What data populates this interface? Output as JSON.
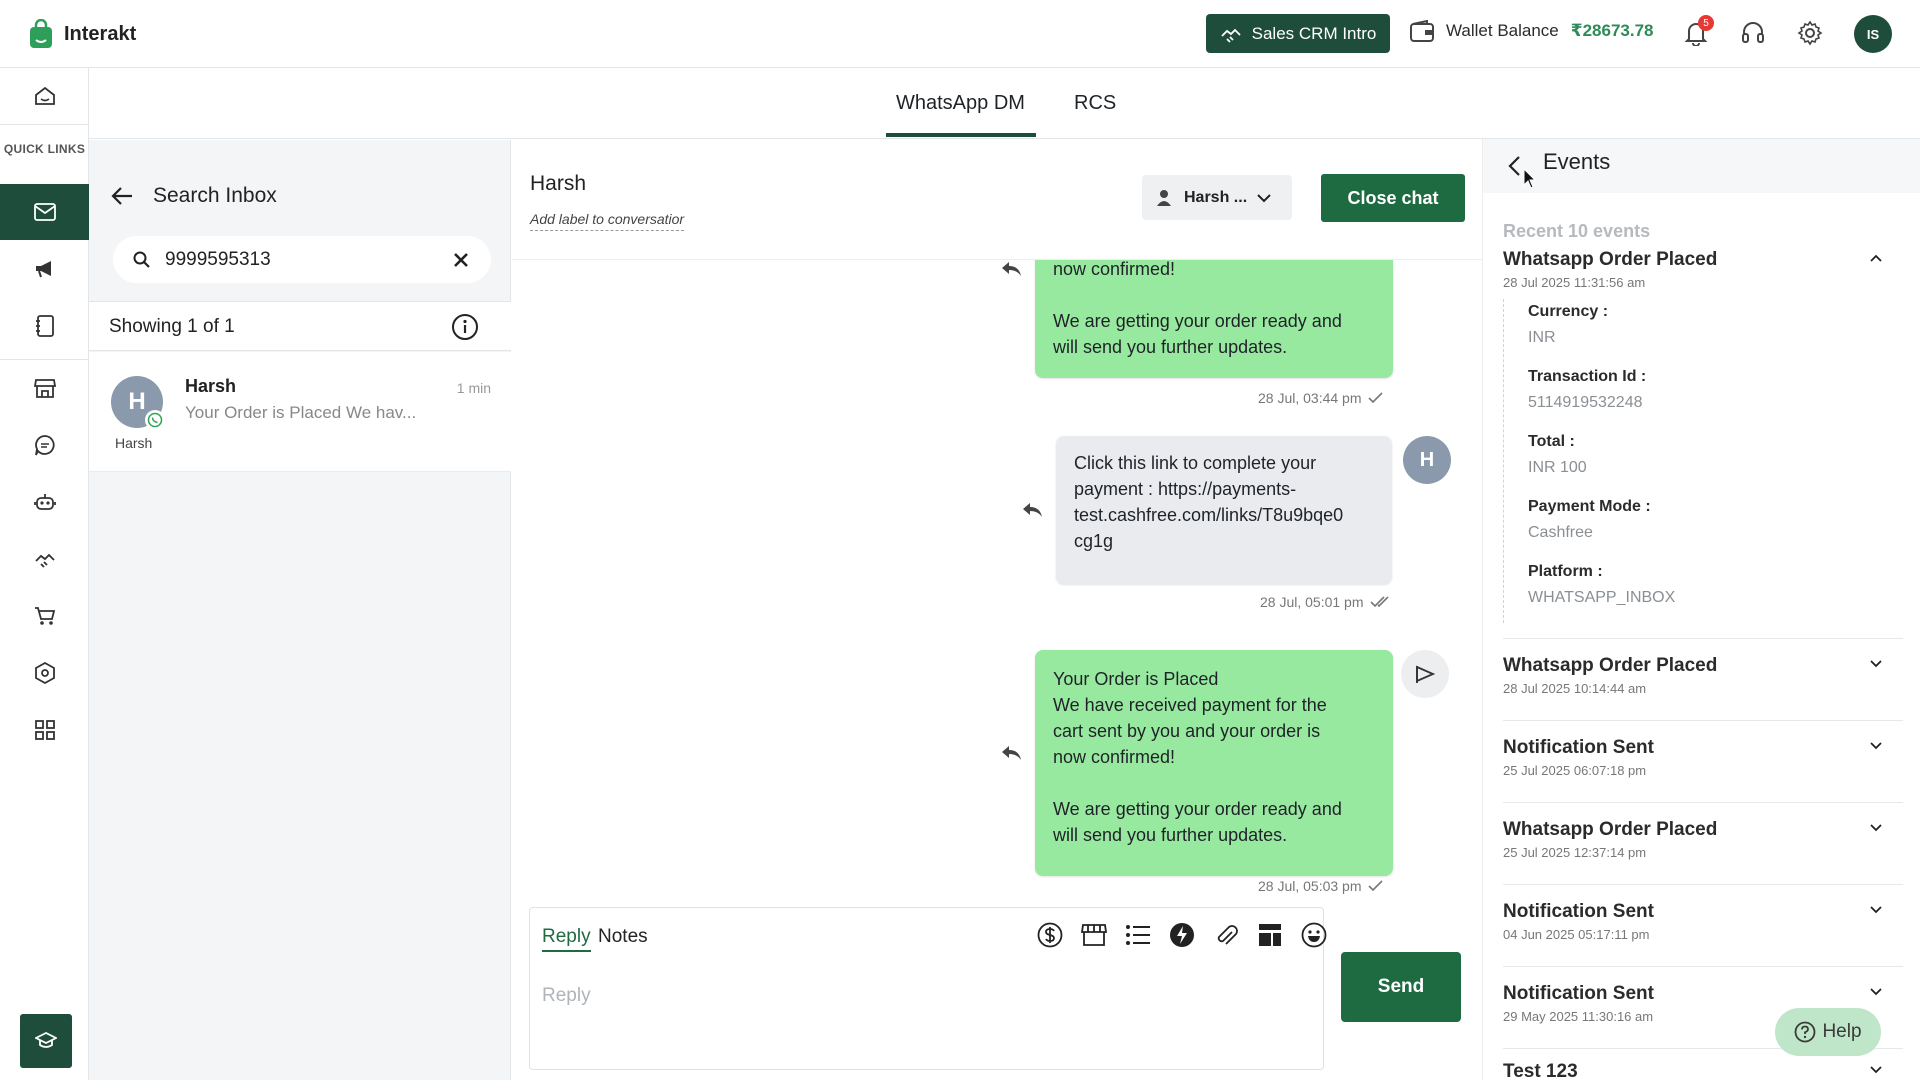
{
  "app": {
    "name": "Interakt"
  },
  "topbar": {
    "crm_button": "Sales CRM Intro",
    "wallet_label": "Wallet Balance",
    "wallet_amount": "₹28673.78",
    "notification_count": "5",
    "user_initials": "IS"
  },
  "rail": {
    "quick_links": "QUICK LINKS"
  },
  "tabs": [
    {
      "label": "WhatsApp DM"
    },
    {
      "label": "RCS"
    }
  ],
  "inbox": {
    "title": "Search Inbox",
    "search_value": "9999595313",
    "showing": "Showing 1 of 1",
    "contacts": [
      {
        "initial": "H",
        "name": "Harsh",
        "time": "1 min",
        "preview": "Your Order is Placed We hav...",
        "sub": "Harsh"
      }
    ]
  },
  "chat": {
    "contact_name": "Harsh",
    "add_label": "Add label to conversatior",
    "assignee": "Harsh ...",
    "close_chat": "Close chat",
    "messages": [
      {
        "line1": "now confirmed!",
        "line2": "We are getting your order ready and",
        "line3": "will send you further updates.",
        "meta": "28 Jul, 03:44 pm"
      },
      {
        "line1": "Click this link to complete your",
        "line2": "payment : https://payments-",
        "line3": "test.cashfree.com/links/T8u9bqe0",
        "line4": "cg1g",
        "avatar": "H",
        "meta": "28 Jul, 05:01 pm"
      },
      {
        "line1": "Your Order is Placed",
        "line2": "We have received payment for the",
        "line3": "cart sent by you and your order is",
        "line4": "now confirmed!",
        "line5": "We are getting your order ready and",
        "line6": "will send you further updates.",
        "meta": "28 Jul, 05:03 pm"
      }
    ],
    "composer": {
      "tab_reply": "Reply",
      "tab_notes": "Notes",
      "placeholder": "Reply",
      "send": "Send"
    }
  },
  "events": {
    "title": "Events",
    "recent": "Recent 10 events",
    "expanded": {
      "name": "Whatsapp Order Placed",
      "date": "28 Jul 2025 11:31:56 am",
      "fields": [
        {
          "key": "Currency :",
          "value": "INR"
        },
        {
          "key": "Transaction Id :",
          "value": "5114919532248"
        },
        {
          "key": "Total :",
          "value": "INR 100"
        },
        {
          "key": "Payment Mode :",
          "value": "Cashfree"
        },
        {
          "key": "Platform :",
          "value": "WHATSAPP_INBOX"
        }
      ]
    },
    "items": [
      {
        "name": "Whatsapp Order Placed",
        "date": "28 Jul 2025 10:14:44 am"
      },
      {
        "name": "Notification Sent",
        "date": "25 Jul 2025 06:07:18 pm"
      },
      {
        "name": "Whatsapp Order Placed",
        "date": "25 Jul 2025 12:37:14 pm"
      },
      {
        "name": "Notification Sent",
        "date": "04 Jun 2025 05:17:11 pm"
      },
      {
        "name": "Notification Sent",
        "date": "29 May 2025 11:30:16 am"
      },
      {
        "name": "Test 123",
        "date": ""
      }
    ],
    "help": "Help"
  },
  "colors": {
    "brand": "#1e4d3b",
    "button_green": "#1e6b41",
    "bubble_out": "#98e9a0",
    "bubble_in": "#e9ebee",
    "wallet_green": "#2e8b57"
  }
}
